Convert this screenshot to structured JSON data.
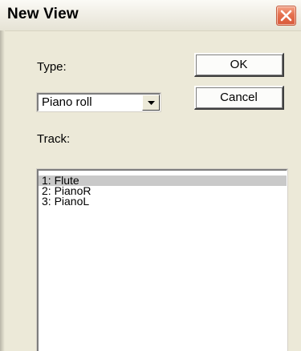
{
  "window": {
    "title": "New View"
  },
  "type_label": "Type:",
  "type_select": {
    "value": "Piano roll"
  },
  "buttons": {
    "ok_label": "OK",
    "cancel_label": "Cancel"
  },
  "track_label": "Track:",
  "tracks": [
    {
      "label": "1: Flute",
      "selected": true
    },
    {
      "label": "2: PianoR",
      "selected": false
    },
    {
      "label": "3: PianoL",
      "selected": false
    }
  ],
  "icons": {
    "close": "close-icon",
    "dropdown": "chevron-down-icon"
  },
  "colors": {
    "dialog_bg": "#ece9d8",
    "close_button": "#e5714f",
    "selected_item_bg": "#c9c9c9"
  }
}
